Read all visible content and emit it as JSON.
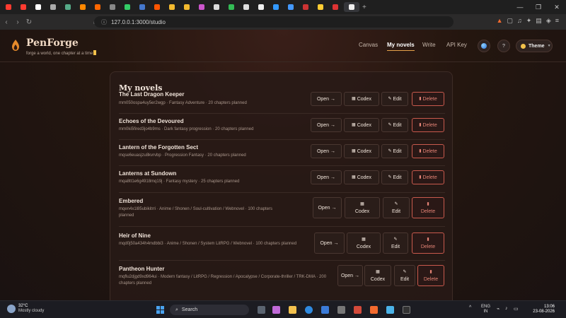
{
  "browser": {
    "tabs": [
      "Y",
      "Y",
      "G",
      "B",
      "P",
      "A",
      "R",
      "G",
      "F",
      "F",
      "A",
      "B",
      "B",
      "Q",
      "X",
      "T",
      "T",
      "G",
      "C",
      "O",
      "G",
      "M",
      "Y",
      "D"
    ],
    "new_tab": "+",
    "url": "127.0.0.1:3000/studio",
    "window_controls": [
      "—",
      "❐",
      "✕"
    ]
  },
  "app": {
    "brand": "PenForge",
    "tagline": "forge a world, one chapter at a time",
    "nav": [
      "Canvas",
      "My novels",
      "Write",
      "API Key"
    ],
    "active_nav": "My novels",
    "help_label": "?",
    "theme_label": "Theme"
  },
  "novels": {
    "title": "My novels",
    "open_label": "Open →",
    "codex_label": "Codex",
    "edit_label": "Edit",
    "delete_label": "Delete",
    "items": [
      {
        "name": "The Last Dragon Keeper",
        "meta": "mm050ospa4uy5er2wgp · Fantasy Adventure · 20 chapters planned"
      },
      {
        "name": "Echoes of the Devoured",
        "meta": "mm0ki5fired3jo4b9ms · Dark fantasy progression · 20 chapters planned"
      },
      {
        "name": "Lantern of the Forgotten Sect",
        "meta": "mqse6euasjzu8kvrvbp · Progression Fantasy · 20 chapters planned"
      },
      {
        "name": "Lanterns at Sundown",
        "meta": "mqa8tt1e6g4918mq19j · Fantasy mystery · 25 chapters planned"
      },
      {
        "name": "Embered",
        "meta": "mqen4x1l85ubikitrri · Anime / Shonen / Soul-cultivation / Webnovel · 100 chapters planned"
      },
      {
        "name": "Heir of Nine",
        "meta": "mqd0j50a434h4mdbbi3 · Anime / Shonen / System LitRPG / Webnovel · 100 chapters planned"
      },
      {
        "name": "Pantheon Hunter",
        "meta": "mqflu2djgd9xd964ui · Modern fantasy / LitRPG / Regression / Apocalypse / Corporate-thriller / TRK-DMA · 200 chapters planned"
      }
    ]
  },
  "taskbar": {
    "temperature": "32°C",
    "weather": "Mostly cloudy",
    "search": "Search",
    "lang_1": "ENG",
    "lang_2": "IN",
    "time": "13:06",
    "date": "23-08-2026",
    "tray": "^"
  },
  "colors": {
    "accent": "#e6a24a",
    "delete": "#c95a4d",
    "cursor": "#f3c24b"
  }
}
